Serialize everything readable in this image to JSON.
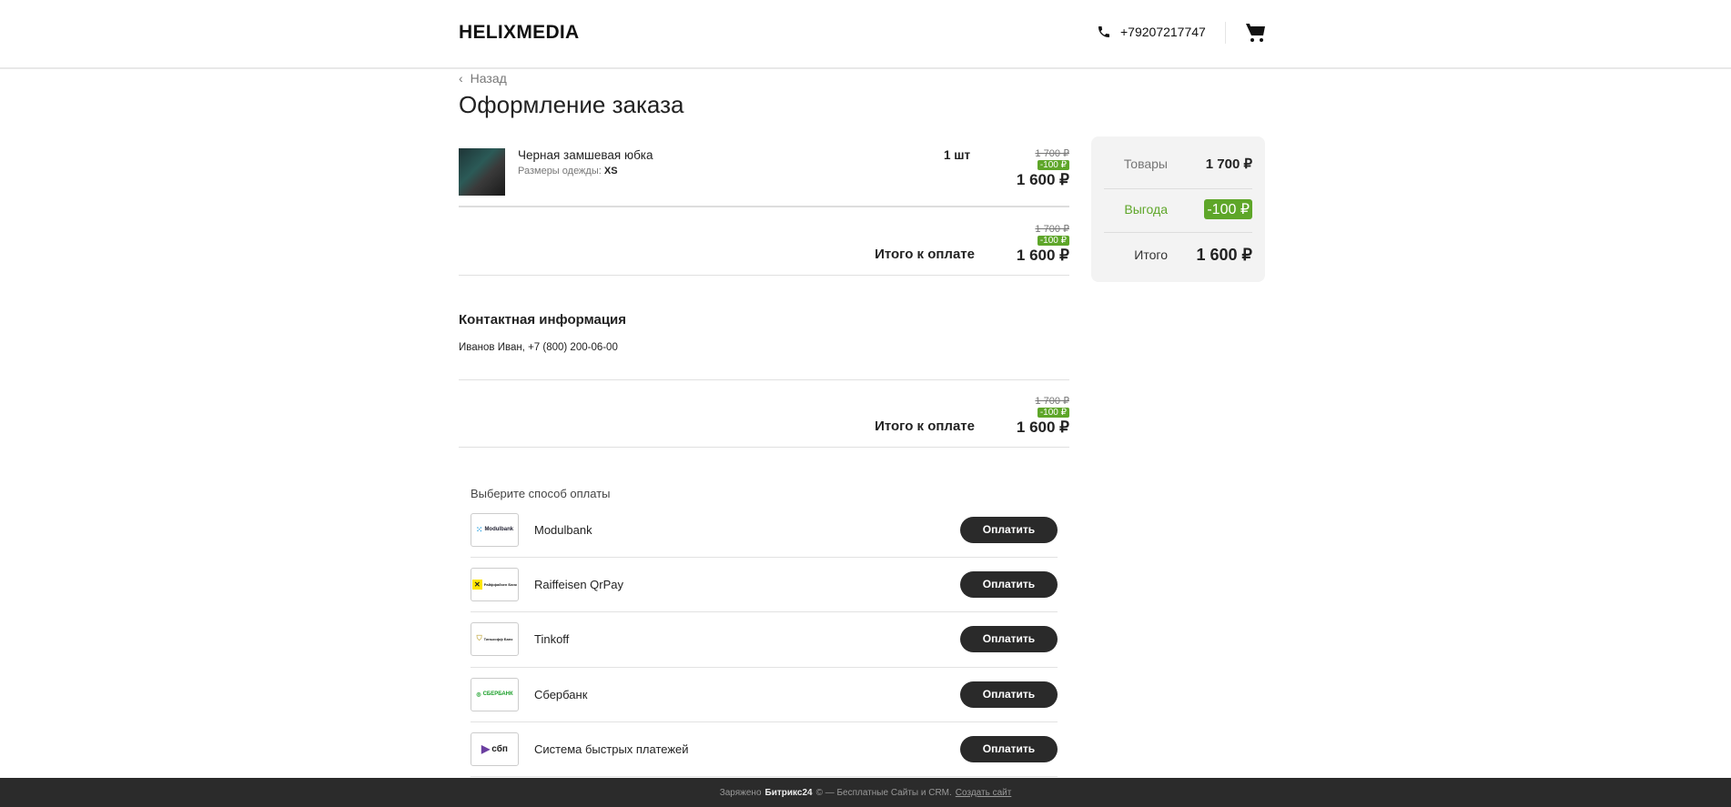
{
  "header": {
    "logo": "HELIXMEDIA",
    "phone": "+79207217747"
  },
  "nav": {
    "back": "Назад"
  },
  "page_title": "Оформление заказа",
  "item": {
    "name": "Черная замшевая юбка",
    "prop_label": "Размеры одежды:",
    "prop_value": "XS",
    "qty": "1 шт",
    "old_price": "1 700 ₽",
    "discount": "-100 ₽",
    "price": "1 600 ₽"
  },
  "totals": {
    "label": "Итого к оплате",
    "old_price": "1 700 ₽",
    "discount": "-100 ₽",
    "price": "1 600 ₽"
  },
  "contact": {
    "heading": "Контактная информация",
    "text": "Иванов Иван, +7 (800) 200-06-00"
  },
  "payment": {
    "heading": "Выберите способ оплаты",
    "button": "Оплатить",
    "methods": [
      {
        "name": "Modulbank",
        "logo": "Modulbank"
      },
      {
        "name": "Raiffeisen QrPay",
        "logo": "Райффайзен Банк"
      },
      {
        "name": "Tinkoff",
        "logo": "Тинькофф Банк"
      },
      {
        "name": "Сбербанк",
        "logo": "СБЕРБАНК"
      },
      {
        "name": "Система быстрых платежей",
        "logo": "сбп"
      }
    ]
  },
  "summary": {
    "goods_label": "Товары",
    "goods_value": "1 700 ₽",
    "benefit_label": "Выгода",
    "benefit_value": "-100 ₽",
    "total_label": "Итого",
    "total_value": "1 600 ₽"
  },
  "footer": {
    "prefix": "Заряжено",
    "brand": "Битрикс24",
    "suffix": "© — Бесплатные Сайты и CRM.",
    "link": "Создать сайт"
  },
  "colors": {
    "accent_green": "#5ea629",
    "button_dark": "#2a2a2a",
    "footer_bg": "#2b2b2b"
  }
}
